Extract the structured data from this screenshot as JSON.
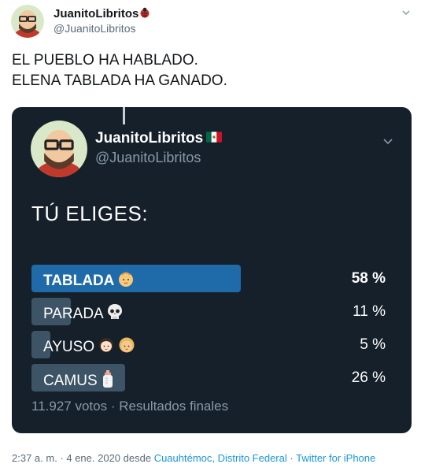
{
  "author": {
    "name": "JuanitoLibritos",
    "name_emoji": "ladybug-icon",
    "handle": "@JuanitoLibritos"
  },
  "tweet": {
    "lines": [
      "EL PUEBLO HA HABLADO.",
      "ELENA TABLADA HA GANADO."
    ]
  },
  "quoted": {
    "name": "JuanitoLibritos",
    "name_emoji": "mexico-flag-icon",
    "handle": "@JuanitoLibritos",
    "question": "TÚ ELIGES:",
    "options": [
      {
        "label": "TABLADA",
        "percent_text": "58 %",
        "percent": 58,
        "winner": true
      },
      {
        "label": "PARADA",
        "percent_text": "11 %",
        "percent": 11,
        "winner": false
      },
      {
        "label": "AYUSO",
        "percent_text": "5 %",
        "percent": 5,
        "winner": false
      },
      {
        "label": "CAMUS",
        "percent_text": "26 %",
        "percent": 26,
        "winner": false
      }
    ],
    "footer": "11.927 votos · Resultados finales"
  },
  "meta": {
    "time": "2:37 a. m. · 4 ene. 2020 desde ",
    "location": "Cuauhtémoc, Distrito Federal",
    "sep": " · ",
    "source": "Twitter for iPhone"
  },
  "colors": {
    "card_bg": "#15202b",
    "winner_bar": "#1f6aa8",
    "other_bar": "#3d5466",
    "link": "#1b95e0"
  }
}
